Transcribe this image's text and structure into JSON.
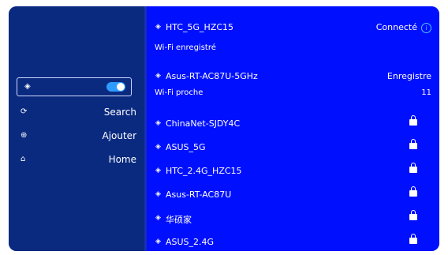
{
  "left_menu": {
    "toggle_icon": "wifi-icon",
    "items": [
      {
        "label": "Search",
        "icon": "refresh-icon"
      },
      {
        "label": "Ajouter",
        "icon": "add-icon"
      },
      {
        "label": "Home",
        "icon": "home-icon"
      }
    ]
  },
  "connected": {
    "ssid": "HTC_5G_HZC15",
    "status": "Connecté",
    "section_label": "Wi-Fi enregistré"
  },
  "saved": [
    {
      "ssid": "Asus-RT-AC87U-5GHz",
      "status": "Enregistre"
    }
  ],
  "nearby": {
    "label": "Wi-Fi proche",
    "count": "11",
    "networks": [
      {
        "ssid": "ChinaNet-SJDY4C"
      },
      {
        "ssid": "ASUS_5G"
      },
      {
        "ssid": "HTC_2.4G_HZC15"
      },
      {
        "ssid": "Asus-RT-AC87U"
      },
      {
        "ssid": "华硕家"
      },
      {
        "ssid": "ASUS_2.4G"
      }
    ]
  },
  "colors": {
    "left_bg": "#0a2a80",
    "right_bg": "#0010ff",
    "toggle_on": "#2d9bff",
    "info": "#4fc0ff"
  }
}
